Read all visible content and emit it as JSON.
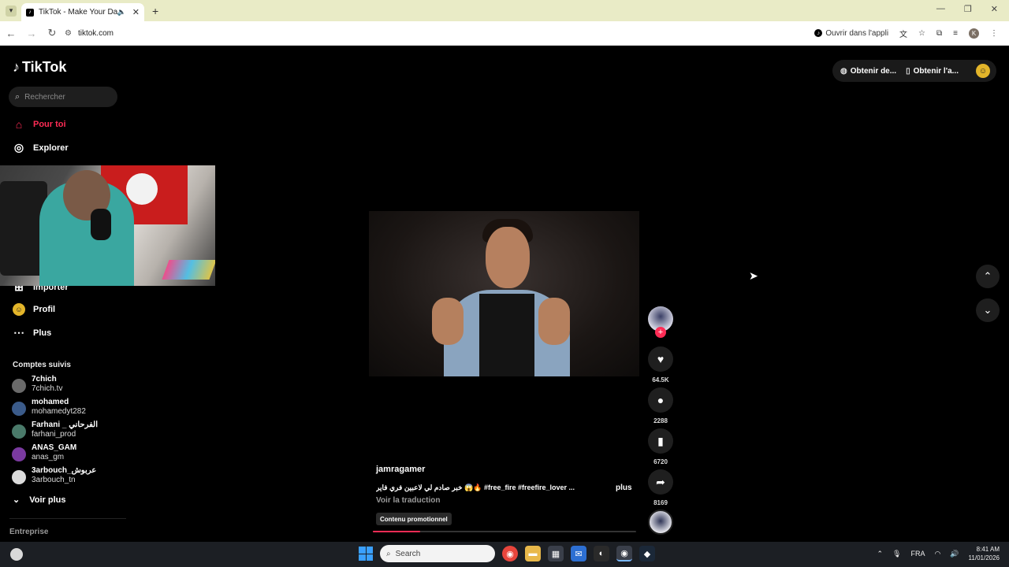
{
  "browser": {
    "tab_title": "TikTok - Make Your Day",
    "url": "tiktok.com",
    "open_in_app": "Ouvrir dans l'appli",
    "profile_letter": "K"
  },
  "tiktok": {
    "logo": "TikTok",
    "search_placeholder": "Rechercher",
    "nav": [
      {
        "label": "Pour toi",
        "icon": "home-icon"
      },
      {
        "label": "Explorer",
        "icon": "compass-icon"
      },
      {
        "label": "Importer",
        "icon": "upload-icon"
      },
      {
        "label": "Profil",
        "icon": "profile-icon"
      },
      {
        "label": "Plus",
        "icon": "more-icon"
      }
    ],
    "following_title": "Comptes suivis",
    "accounts": [
      {
        "name": "7chich",
        "handle": "7chich.tv",
        "color": "#6a6a6a"
      },
      {
        "name": "mohamed",
        "handle": "mohamedyt282",
        "color": "#3b5b8a"
      },
      {
        "name": "Farhani _ الفرحاني",
        "handle": "farhani_prod",
        "color": "#4a7a6a"
      },
      {
        "name": "ANAS_GAM",
        "handle": "anas_gm",
        "color": "#7a3aa0"
      },
      {
        "name": "3arbouch_عربوش",
        "handle": "3arbouch_tn",
        "color": "#dcdcdc"
      }
    ],
    "see_more": "Voir plus",
    "company": "Entreprise",
    "top_buttons": {
      "get_desktop": "Obtenir de...",
      "get_app": "Obtenir l'a..."
    },
    "video": {
      "author": "jamragamer",
      "caption": "خبر صادم لي لاعبين فري فاير 😱🔥 #free_fire #freefire_lover ...",
      "more": "plus",
      "translate": "Voir la traduction",
      "promo": "Contenu promotionnel",
      "progress": 0.18
    },
    "actions": {
      "likes": "64.5K",
      "comments": "2288",
      "saves": "6720",
      "shares": "8169"
    }
  },
  "taskbar": {
    "search_placeholder": "Search",
    "lang": "FRA",
    "time": "8:41 AM",
    "date": "11/01/2026"
  }
}
